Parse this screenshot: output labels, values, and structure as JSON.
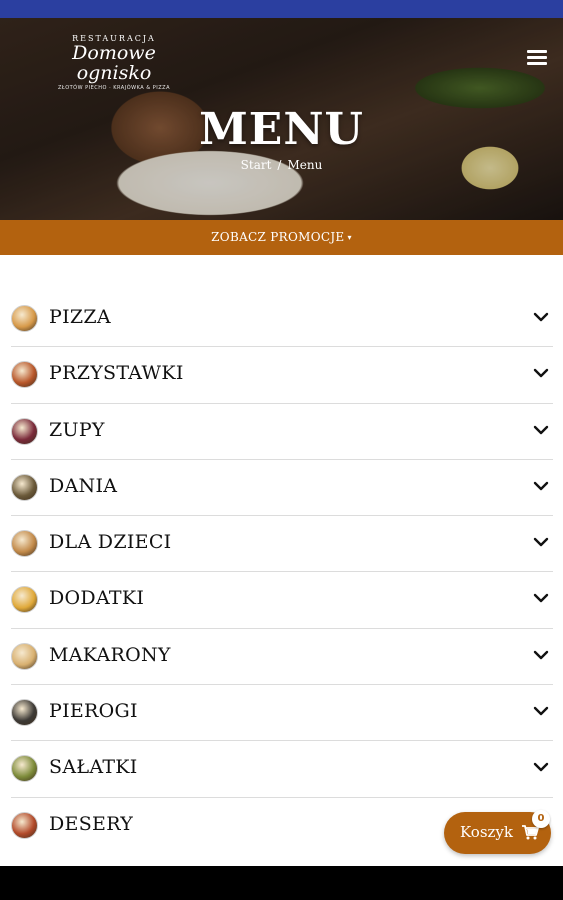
{
  "header": {
    "logo": {
      "top": "RESTAURACJA",
      "name": "Domowe ognisko",
      "sub": "ZŁOTÓW PIECHO · KRAJÓWKA & PIZZA"
    },
    "menu_icon": "hamburger-icon"
  },
  "hero": {
    "title": "MENU",
    "breadcrumb": {
      "start": "Start",
      "separator": "/",
      "current": "Menu"
    }
  },
  "promo": {
    "label": "ZOBACZ PROMOCJE",
    "caret": "▾"
  },
  "categories": [
    {
      "label": "PIZZA",
      "icon": "pizza-icon",
      "color": "#d79a4a"
    },
    {
      "label": "PRZYSTAWKI",
      "icon": "appetizer-icon",
      "color": "#b8572a"
    },
    {
      "label": "ZUPY",
      "icon": "soup-icon",
      "color": "#7a2a3a"
    },
    {
      "label": "DANIA",
      "icon": "main-dish-icon",
      "color": "#6b5a3a"
    },
    {
      "label": "DLA DZIECI",
      "icon": "kids-meal-icon",
      "color": "#c28a4a"
    },
    {
      "label": "DODATKI",
      "icon": "side-dish-icon",
      "color": "#e0a93a"
    },
    {
      "label": "MAKARONY",
      "icon": "pasta-icon",
      "color": "#d8b070"
    },
    {
      "label": "PIEROGI",
      "icon": "dumplings-icon",
      "color": "#3d3a36"
    },
    {
      "label": "SAŁATKI",
      "icon": "salad-icon",
      "color": "#7d8b3a"
    },
    {
      "label": "DESERY",
      "icon": "dessert-icon",
      "color": "#b24a2a"
    }
  ],
  "cart": {
    "label": "Koszyk",
    "count": "0",
    "icon": "cart-icon"
  },
  "colors": {
    "accent": "#b3620f",
    "status_bar": "#2b3fa0"
  }
}
